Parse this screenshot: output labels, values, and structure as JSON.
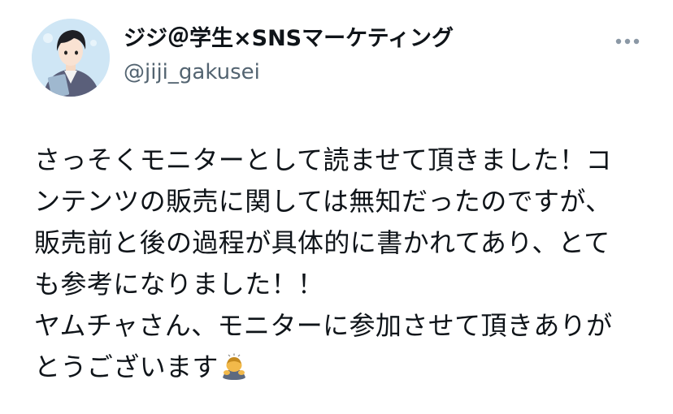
{
  "author": {
    "display_name": "ジジ＠学生×SNSマーケティング",
    "handle": "@jiji_gakusei"
  },
  "more_icon": "more-horizontal-icon",
  "tweet": {
    "lines": [
      "さっそくモニターとして読ませて頂きました！コ",
      "ンテンツの販売に関しては無知だったのですが、",
      "販売前と後の過程が具体的に書かれてあり、とて",
      "も参考になりました！！",
      "ヤムチャさん、モニターに参加させて頂きありが",
      "とうございます"
    ],
    "emoji": "bowing-person-emoji"
  },
  "colors": {
    "text": "#0f1419",
    "secondary_text": "#536471",
    "avatar_bg": "#cfe6f5"
  }
}
